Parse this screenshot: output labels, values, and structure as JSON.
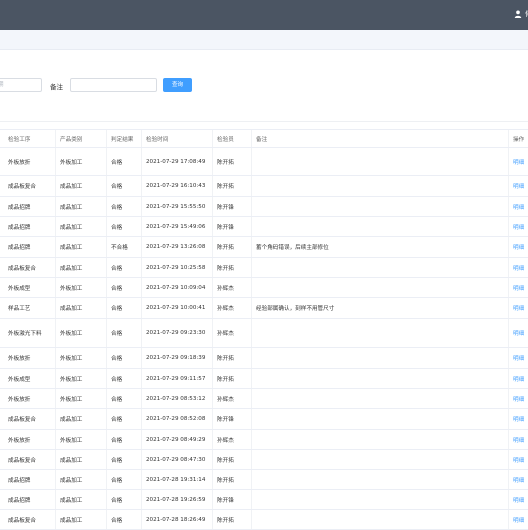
{
  "header": {
    "user_label": "何"
  },
  "filter": {
    "date_placeholder": "束日期",
    "remark_label": "备注",
    "remark_placeholder": "",
    "query_button": "查询"
  },
  "table": {
    "columns": [
      "检验工序",
      "产品类别",
      "判定结果",
      "检验时间",
      "检验员",
      "备注",
      "操作"
    ],
    "action_label": "明细",
    "rows": [
      [
        "外板放折",
        "外板加工",
        "合格",
        "2021-07-29 17:08:49",
        "陈开拓",
        ""
      ],
      [
        "成品板复合",
        "成品加工",
        "合格",
        "2021-07-29 16:10:43",
        "陈开拓",
        ""
      ],
      [
        "成品招牌",
        "成品加工",
        "合格",
        "2021-07-29 15:55:50",
        "陈开锋",
        ""
      ],
      [
        "成品招牌",
        "成品加工",
        "合格",
        "2021-07-29 15:49:06",
        "陈开锋",
        ""
      ],
      [
        "成品招牌",
        "成品加工",
        "不合格",
        "2021-07-29 13:26:08",
        "陈开拓",
        "蓄个角码错误，后续主部修位"
      ],
      [
        "成品板复合",
        "成品加工",
        "合格",
        "2021-07-29 10:25:58",
        "陈开拓",
        ""
      ],
      [
        "外板成型",
        "外板加工",
        "合格",
        "2021-07-29 10:09:04",
        "孙辉杰",
        ""
      ],
      [
        "样品工艺",
        "成品加工",
        "合格",
        "2021-07-29 10:00:41",
        "孙辉杰",
        "经验部属确认，刻样不用管尺寸"
      ],
      [
        "外板激光下料",
        "外板加工",
        "合格",
        "2021-07-29 09:23:30",
        "孙辉杰",
        ""
      ],
      [
        "外板放折",
        "外板加工",
        "合格",
        "2021-07-29 09:18:39",
        "陈开拓",
        ""
      ],
      [
        "外板成型",
        "外板加工",
        "合格",
        "2021-07-29 09:11:57",
        "陈开拓",
        ""
      ],
      [
        "外板放折",
        "外板加工",
        "合格",
        "2021-07-29 08:53:12",
        "孙辉杰",
        ""
      ],
      [
        "成品板复合",
        "成品加工",
        "合格",
        "2021-07-29 08:52:08",
        "陈开锋",
        ""
      ],
      [
        "外板放折",
        "外板加工",
        "合格",
        "2021-07-29 08:49:29",
        "孙辉杰",
        ""
      ],
      [
        "成品板复合",
        "成品加工",
        "合格",
        "2021-07-29 08:47:30",
        "陈开拓",
        ""
      ],
      [
        "成品招牌",
        "成品加工",
        "合格",
        "2021-07-28 19:31:14",
        "陈开拓",
        ""
      ],
      [
        "成品招牌",
        "成品加工",
        "合格",
        "2021-07-28 19:26:59",
        "陈开锋",
        ""
      ],
      [
        "成品板复合",
        "成品加工",
        "合格",
        "2021-07-28 18:26:49",
        "陈开拓",
        ""
      ]
    ]
  }
}
